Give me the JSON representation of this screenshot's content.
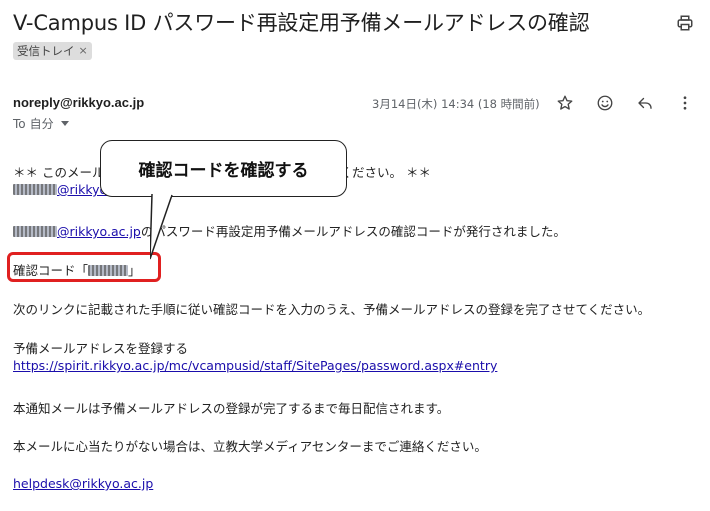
{
  "email": {
    "subject": "V-Campus ID パスワード再設定用予備メールアドレスの確認",
    "label": "受信トレイ",
    "label_remove": "×",
    "sender": "noreply@rikkyo.ac.jp",
    "recipient_prefix": "To",
    "recipient": "自分",
    "date": "3月14日(木) 14:34 (18 時間前)"
  },
  "icons": {
    "print": "print-icon",
    "star": "star-icon",
    "emoji": "emoji-icon",
    "reply": "reply-icon",
    "more": "more-vert-icon",
    "label_chip_close": "close-icon",
    "recipient_toggle": "caret-down-icon"
  },
  "body": {
    "line1_start": "＊＊ このメール",
    "line1_end": "ください。 ＊＊",
    "line2_domain": "@rikkyo.a",
    "line3_domain": "@rikkyo.ac.jp",
    "line3_rest": "のパスワード再設定用予備メールアドレスの確認コードが発行されました。",
    "code_label": "確認コード「",
    "code_close": "」",
    "instruction": "次のリンクに記載された手順に従い確認コードを入力のうえ、予備メールアドレスの登録を完了させてください。",
    "register_heading": "予備メールアドレスを登録する",
    "register_link": "https://spirit.rikkyo.ac.jp/mc/vcampusid/staff/SitePages/password.aspx#entry",
    "notice": "本通知メールは予備メールアドレスの登録が完了するまで毎日配信されます。",
    "contact": "本メールに心当たりがない場合は、立教大学メディアセンターまでご連絡ください。",
    "helpdesk": "helpdesk@rikkyo.ac.jp"
  },
  "annotation": {
    "callout_text": "確認コードを確認する",
    "highlight_color": "#e02020"
  }
}
